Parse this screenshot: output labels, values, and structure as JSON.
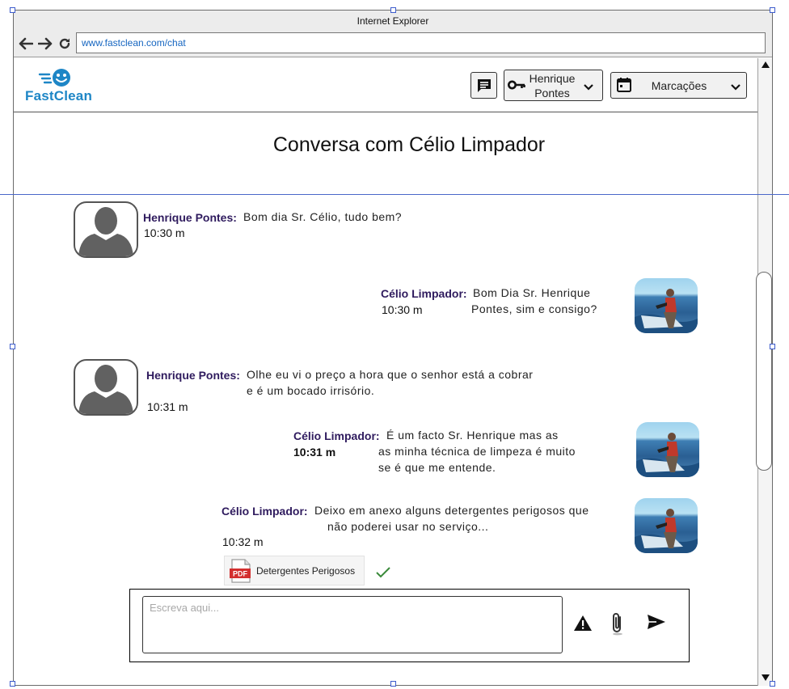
{
  "browser": {
    "title": "Internet Explorer",
    "url": "www.fastclean.com/chat"
  },
  "header": {
    "logo_text": "FastClean",
    "user_name": "Henrique Pontes",
    "appointments_label": "Marcações"
  },
  "page": {
    "title": "Conversa com Célio Limpador"
  },
  "messages": [
    {
      "sender": "Henrique Pontes:",
      "lines": [
        "Bom dia Sr. Célio, tudo bem?"
      ],
      "time": "10:30 m"
    },
    {
      "sender": "Célio Limpador:",
      "lines": [
        "Bom Dia Sr. Henrique",
        "Pontes, sim e consigo?"
      ],
      "time": "10:30 m"
    },
    {
      "sender": "Henrique Pontes:",
      "lines": [
        "Olhe eu vi o preço a hora que o senhor está a cobrar",
        "e é um bocado irrisório."
      ],
      "time": "10:31 m"
    },
    {
      "sender": "Célio Limpador:",
      "lines": [
        "É um facto Sr. Henrique mas as",
        "as minha técnica de limpeza é muito",
        "se é que me entende."
      ],
      "time": "10:31 m"
    },
    {
      "sender": "Célio Limpador:",
      "lines": [
        "Deixo em anexo alguns detergentes perigosos que",
        "não poderei usar no serviço..."
      ],
      "time": "10:32 m"
    }
  ],
  "attachment": {
    "file_name": "Detergentes Perigosos",
    "file_badge": "PDF"
  },
  "composer": {
    "placeholder": "Escreva aqui..."
  },
  "icons": {
    "back": "arrow-left-icon",
    "forward": "arrow-right-icon",
    "refresh": "refresh-icon",
    "chat": "chat-icon",
    "key": "key-icon",
    "calendar": "calendar-icon",
    "chevron": "chevron-down-icon",
    "warning": "warning-icon",
    "paperclip": "paperclip-icon",
    "send": "send-icon",
    "check": "check-icon"
  },
  "colors": {
    "brand": "#1e86c6",
    "sender_name": "#2f1b5e",
    "url_text": "#1565c0",
    "check": "#3a8a3a"
  }
}
